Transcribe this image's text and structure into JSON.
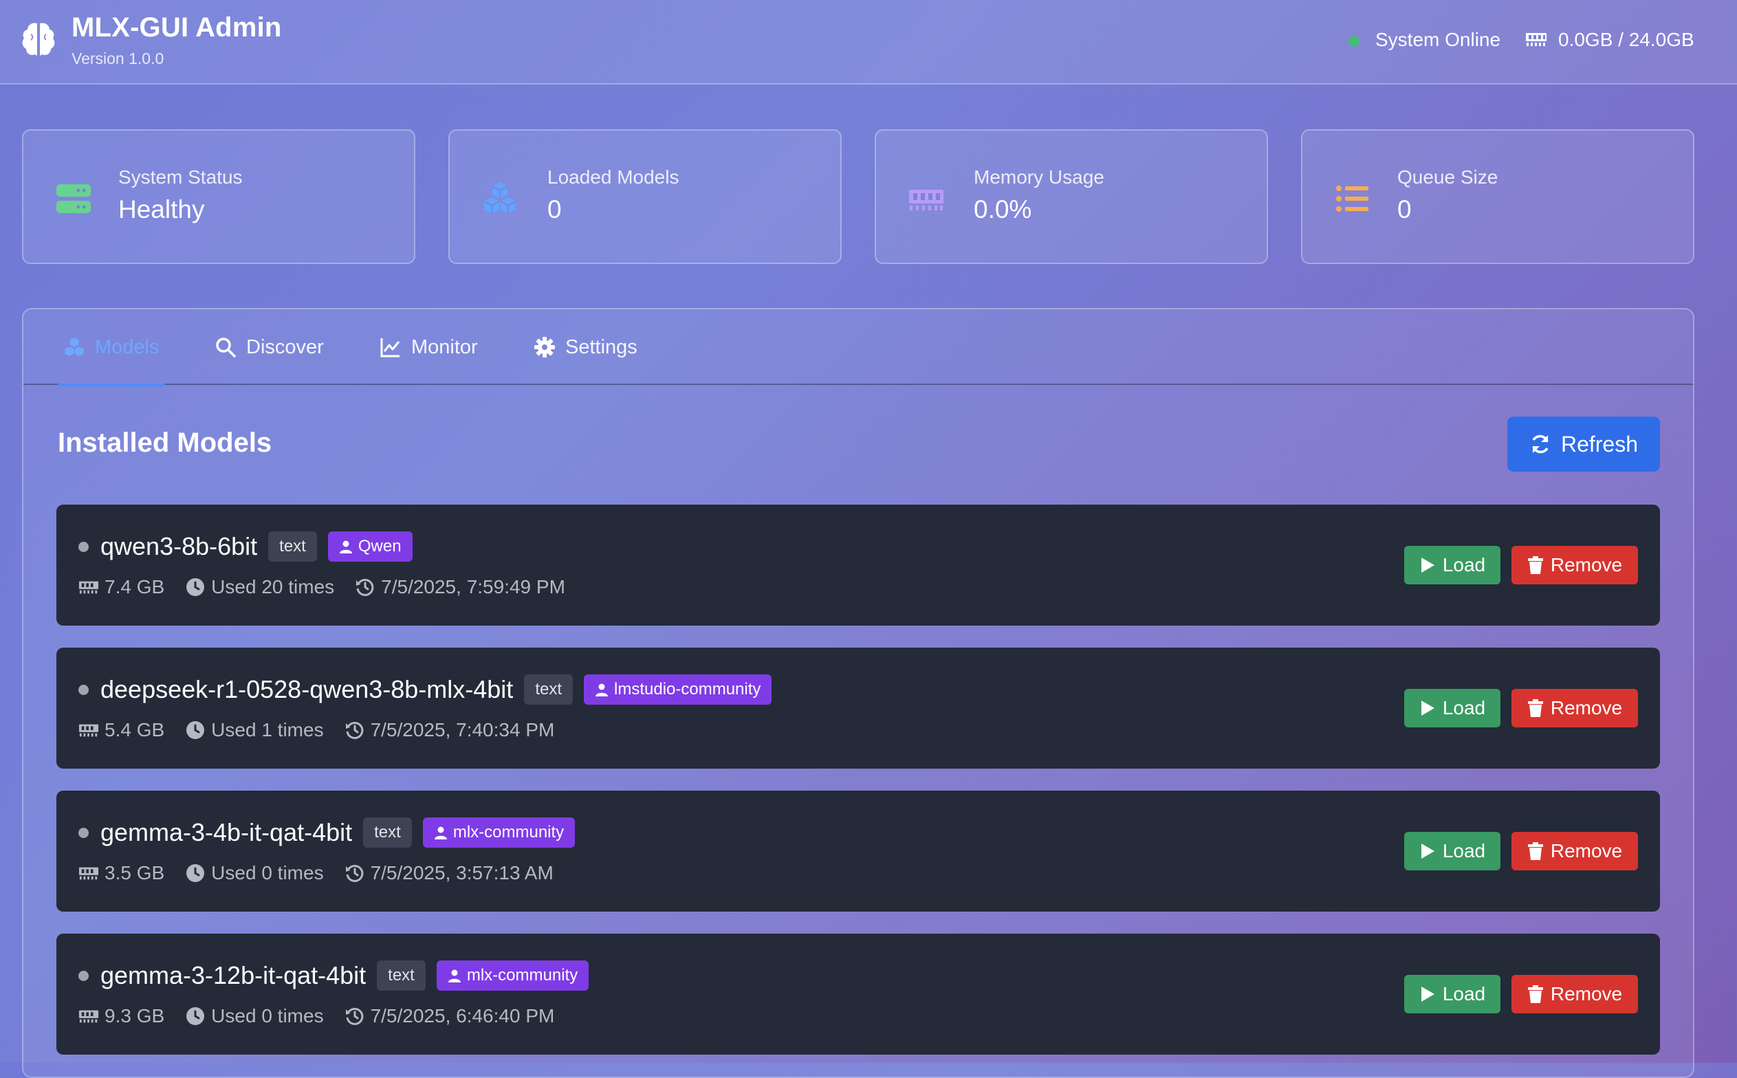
{
  "header": {
    "title": "MLX-GUI Admin",
    "version": "Version 1.0.0",
    "status_text": "System Online",
    "memory_text": "0.0GB / 24.0GB",
    "status_color": "#48bb78"
  },
  "stats": [
    {
      "label": "System Status",
      "value": "Healthy",
      "icon": "server-icon",
      "color": "#68d391"
    },
    {
      "label": "Loaded Models",
      "value": "0",
      "icon": "cubes-icon",
      "color": "#63a4ff"
    },
    {
      "label": "Memory Usage",
      "value": "0.0%",
      "icon": "memory-icon",
      "color": "#b79cf8"
    },
    {
      "label": "Queue Size",
      "value": "0",
      "icon": "list-icon",
      "color": "#f6ad55"
    }
  ],
  "tabs": [
    {
      "label": "Models",
      "icon": "cubes-icon",
      "active": true
    },
    {
      "label": "Discover",
      "icon": "search-icon",
      "active": false
    },
    {
      "label": "Monitor",
      "icon": "chart-line-icon",
      "active": false
    },
    {
      "label": "Settings",
      "icon": "gear-icon",
      "active": false
    }
  ],
  "main": {
    "section_title": "Installed Models",
    "refresh_label": "Refresh"
  },
  "models": [
    {
      "name": "qwen3-8b-6bit",
      "type": "text",
      "author": "Qwen",
      "size": "7.4 GB",
      "usage": "Used 20 times",
      "last_used": "7/5/2025, 7:59:49 PM"
    },
    {
      "name": "deepseek-r1-0528-qwen3-8b-mlx-4bit",
      "type": "text",
      "author": "lmstudio-community",
      "size": "5.4 GB",
      "usage": "Used 1 times",
      "last_used": "7/5/2025, 7:40:34 PM"
    },
    {
      "name": "gemma-3-4b-it-qat-4bit",
      "type": "text",
      "author": "mlx-community",
      "size": "3.5 GB",
      "usage": "Used 0 times",
      "last_used": "7/5/2025, 3:57:13 AM"
    },
    {
      "name": "gemma-3-12b-it-qat-4bit",
      "type": "text",
      "author": "mlx-community",
      "size": "9.3 GB",
      "usage": "Used 0 times",
      "last_used": "7/5/2025, 6:46:40 PM"
    }
  ],
  "model_actions": {
    "load_label": "Load",
    "remove_label": "Remove"
  }
}
